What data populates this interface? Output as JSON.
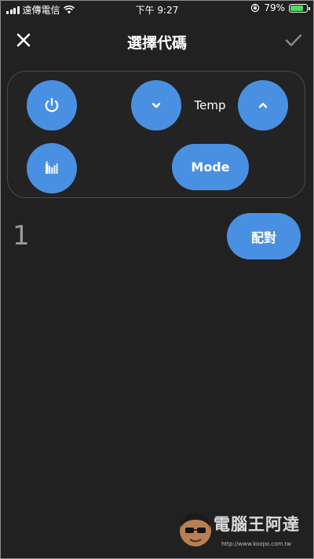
{
  "status_bar": {
    "carrier": "遠傳電信",
    "time": "下午 9:27",
    "battery": "79%",
    "battery_level": 0.79
  },
  "header": {
    "title": "選擇代碼",
    "close_icon": "close-icon",
    "confirm_icon": "checkmark-icon"
  },
  "remote": {
    "power_icon": "power-icon",
    "temp_down_icon": "chevron-down-icon",
    "temp_label": "Temp",
    "temp_up_icon": "chevron-up-icon",
    "fan_icon": "fan-speed-icon",
    "mode_label": "Mode"
  },
  "code": {
    "number": "1",
    "pair_label": "配對"
  },
  "watermark": {
    "text": "電腦王阿達",
    "url": "http://www.koopo.com.tw"
  },
  "colors": {
    "background": "#212121",
    "accent": "#4a90e2",
    "code_text": "#9a9a9a"
  }
}
